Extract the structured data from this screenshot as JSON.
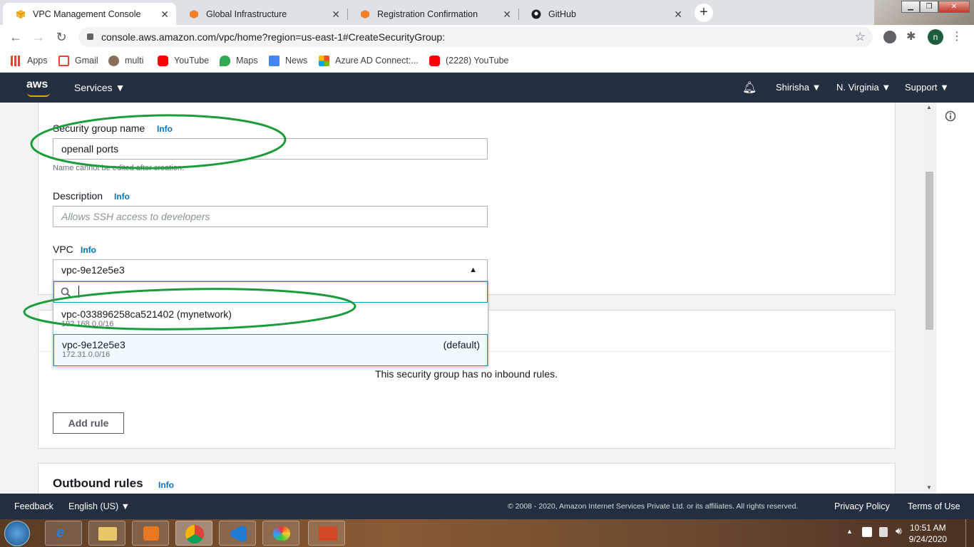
{
  "browser": {
    "tabs": [
      {
        "title": "VPC Management Console",
        "active": true
      },
      {
        "title": "Global Infrastructure",
        "active": false
      },
      {
        "title": "Registration Confirmation",
        "active": false
      },
      {
        "title": "GitHub",
        "active": false
      }
    ],
    "url": "console.aws.amazon.com/vpc/home?region=us-east-1#CreateSecurityGroup:",
    "profile_initial": "n",
    "bookmarks": [
      "Apps",
      "Gmail",
      "multi",
      "YouTube",
      "Maps",
      "News",
      "Azure AD Connect:...",
      "(2228) YouTube"
    ]
  },
  "aws_nav": {
    "logo": "aws",
    "services": "Services ▼",
    "user": "Shirisha ▼",
    "region": "N. Virginia ▼",
    "support": "Support ▼"
  },
  "form": {
    "sg_name_label": "Security group name",
    "info": "Info",
    "sg_name_value": "openall ports",
    "sg_name_hint": "Name cannot be edited after creation.",
    "description_label": "Description",
    "description_placeholder": "Allows SSH access to developers",
    "vpc_label": "VPC",
    "vpc_selected": "vpc-9e12e5e3"
  },
  "vpc_dropdown": {
    "options": [
      {
        "id": "vpc-033896258ca521402 (mynetwork)",
        "cidr": "192.168.0.0/16",
        "tag": ""
      },
      {
        "id": "vpc-9e12e5e3",
        "cidr": "172.31.0.0/16",
        "tag": "(default)"
      }
    ]
  },
  "inbound": {
    "empty_text": "This security group has no inbound rules.",
    "add_rule": "Add rule"
  },
  "outbound": {
    "title": "Outbound rules",
    "info": "Info"
  },
  "footer": {
    "feedback": "Feedback",
    "language": "English (US) ▼",
    "copyright": "© 2008 - 2020, Amazon Internet Services Private Ltd. or its affiliates. All rights reserved.",
    "privacy": "Privacy Policy",
    "terms": "Terms of Use"
  },
  "taskbar": {
    "time": "10:51 AM",
    "date": "9/24/2020"
  },
  "colors": {
    "aws_nav": "#232f3e",
    "link": "#0073bb",
    "annotation": "#1a9c3a",
    "focus": "#00a1c9"
  }
}
